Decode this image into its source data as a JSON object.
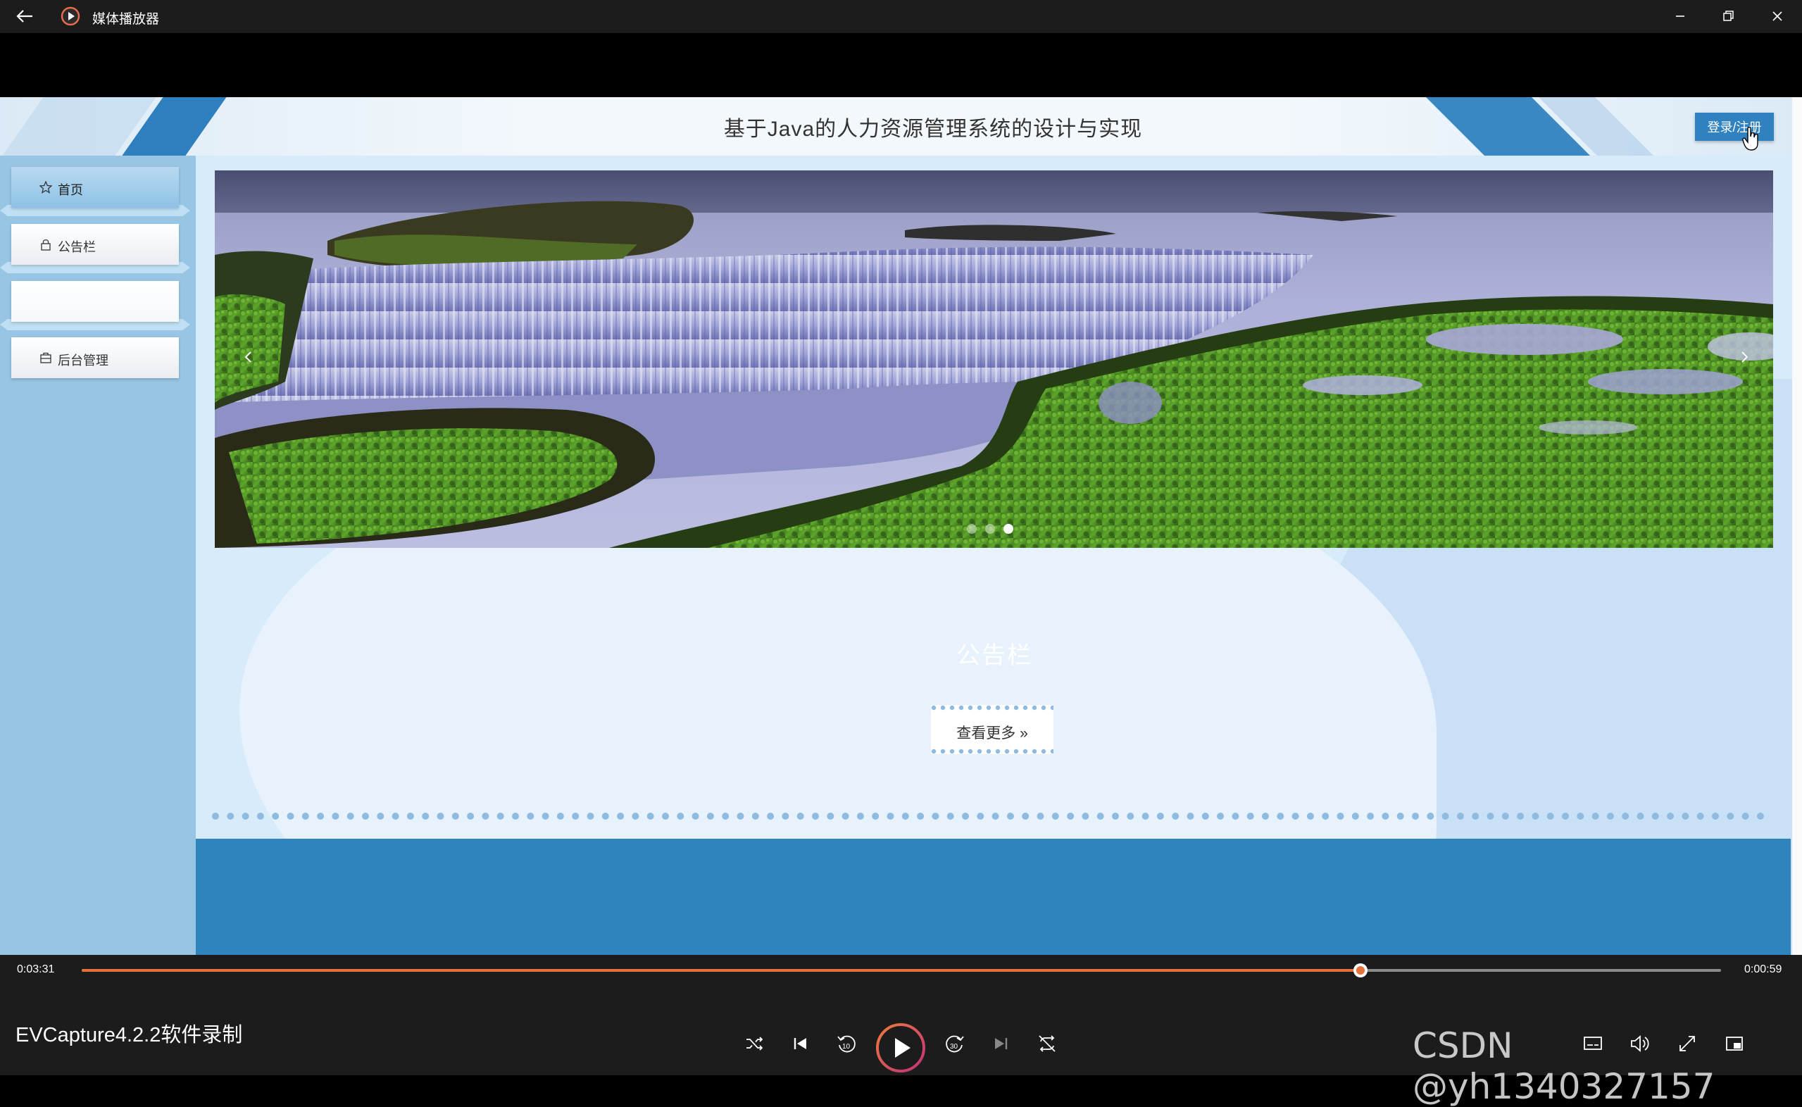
{
  "window": {
    "title": "媒体播放器"
  },
  "page": {
    "title": "基于Java的人力资源管理系统的设计与实现",
    "login_label": "登录/注册"
  },
  "sidebar": {
    "items": [
      {
        "label": "首页",
        "icon": "star-icon"
      },
      {
        "label": "公告栏",
        "icon": "lock-icon"
      },
      {
        "label": "",
        "icon": "blank"
      },
      {
        "label": "后台管理",
        "icon": "briefcase-icon"
      }
    ]
  },
  "carousel": {
    "slides": 3,
    "active_slide": 3
  },
  "notice": {
    "title": "公告栏",
    "view_more": "查看更多"
  },
  "player": {
    "current_time": "0:03:31",
    "remaining_time": "0:00:59",
    "progress_fraction": 0.78,
    "media_title": "EVCapture4.2.2软件录制",
    "accent": "#e8733a"
  },
  "watermark": "CSDN @yh1340327157"
}
